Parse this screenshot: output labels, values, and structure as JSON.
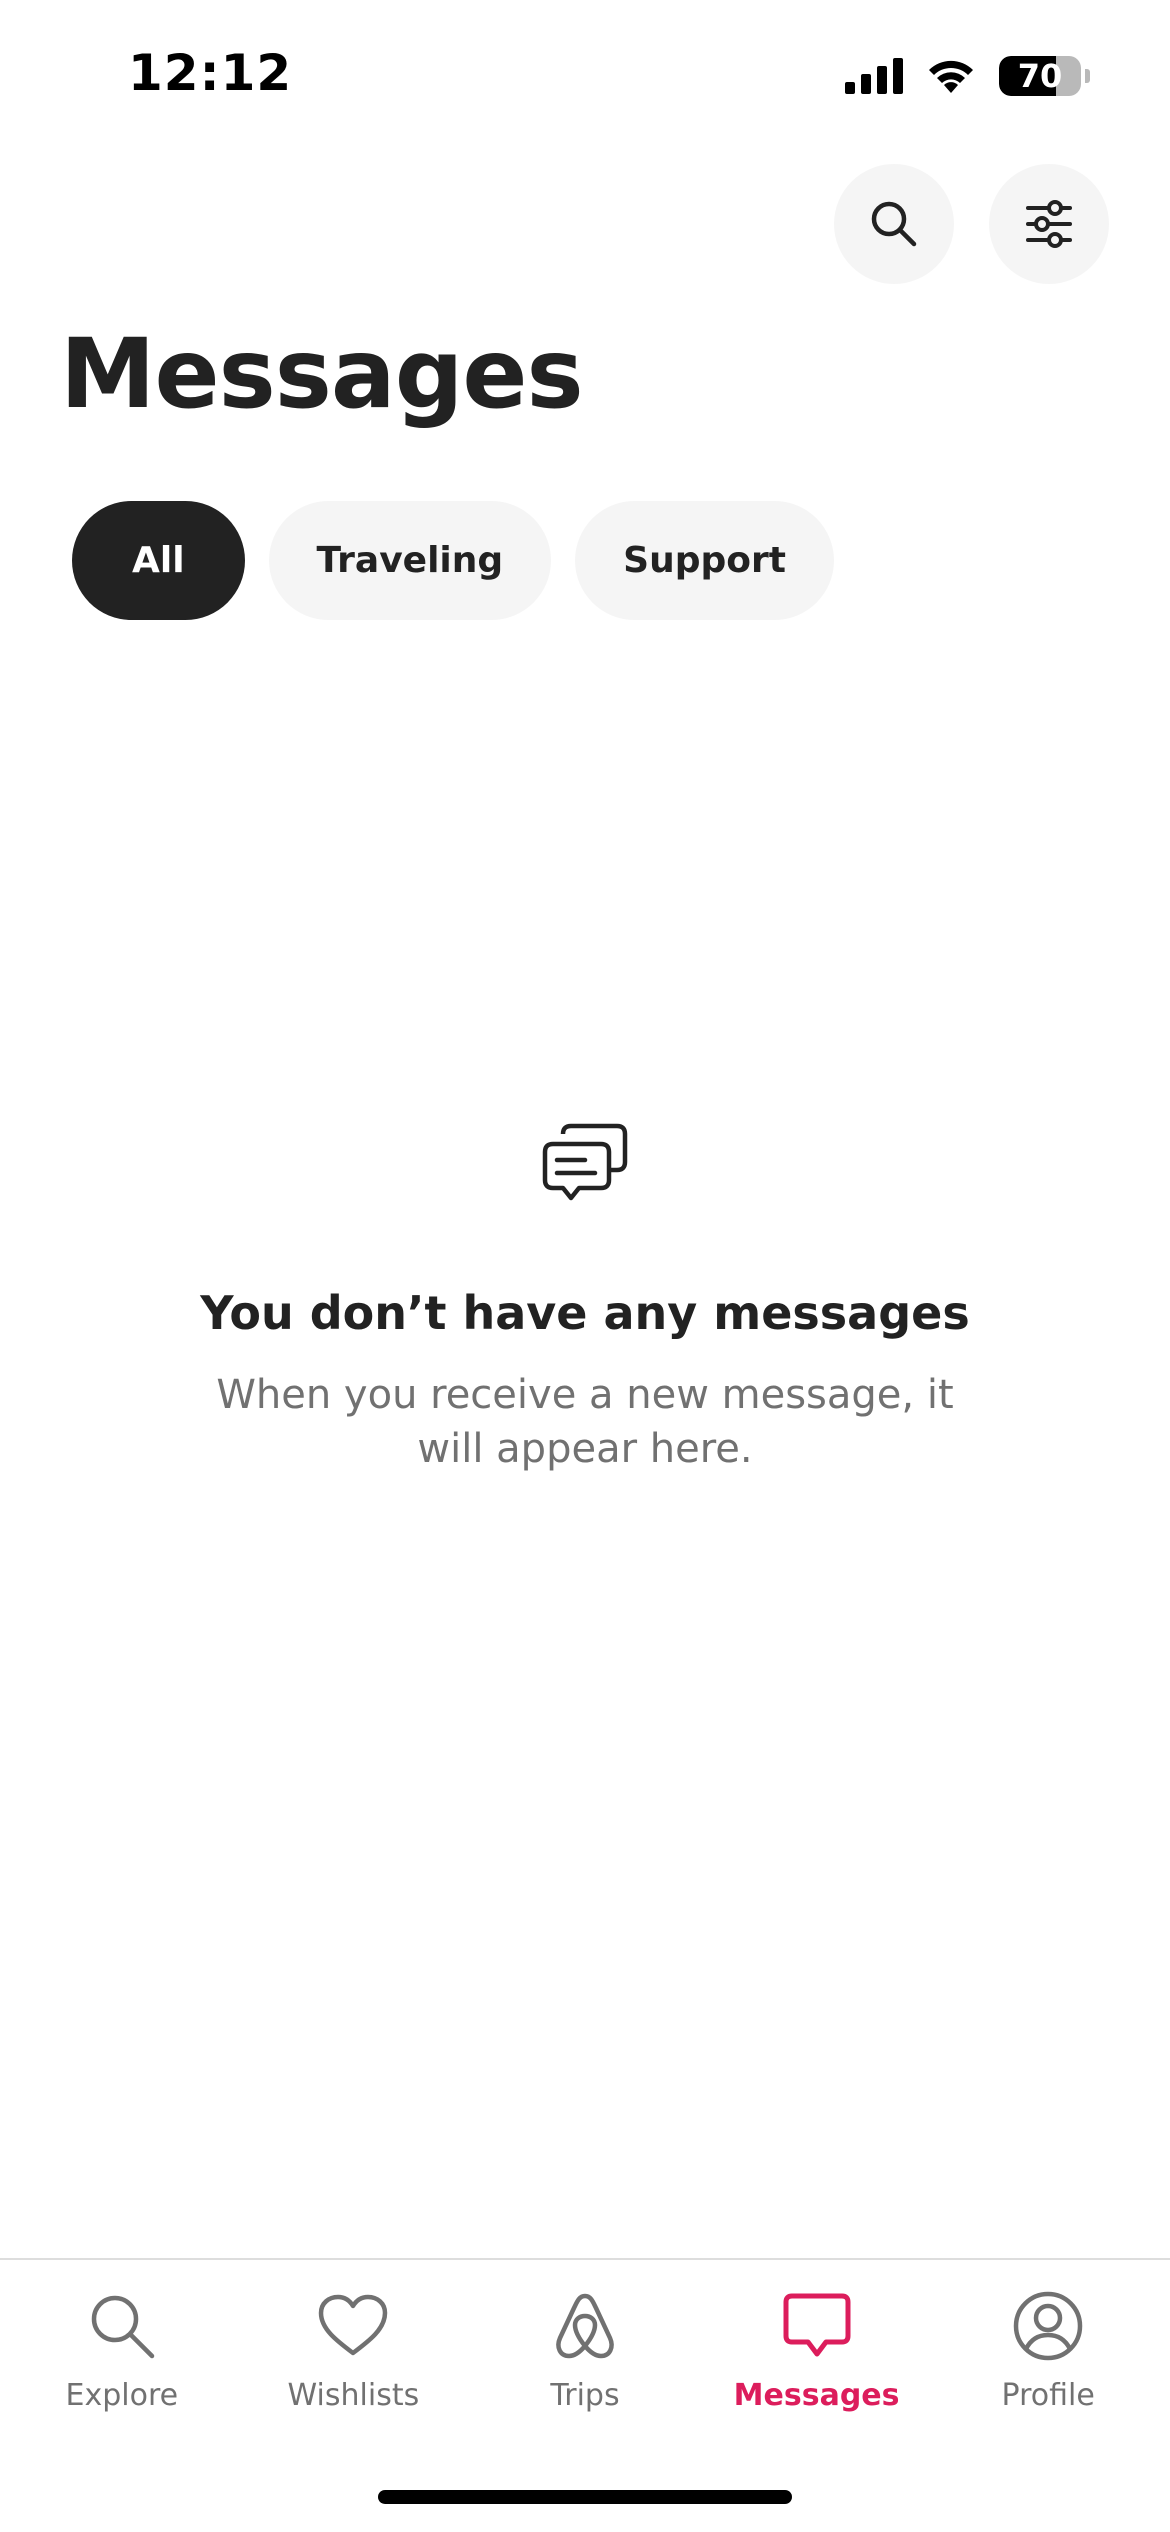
{
  "status_bar": {
    "time": "12:12",
    "battery_level": 70,
    "battery_text": "70"
  },
  "header": {
    "title": "Messages",
    "search_icon": "search-icon",
    "filter_icon": "sliders-icon"
  },
  "filters": [
    {
      "label": "All",
      "active": true
    },
    {
      "label": "Traveling",
      "active": false
    },
    {
      "label": "Support",
      "active": false
    }
  ],
  "empty_state": {
    "icon": "chat-bubbles-icon",
    "title": "You don’t have any messages",
    "subtitle": "When you receive a new message, it will appear here."
  },
  "nav": {
    "items": [
      {
        "label": "Explore",
        "icon": "search-icon",
        "active": false
      },
      {
        "label": "Wishlists",
        "icon": "heart-icon",
        "active": false
      },
      {
        "label": "Trips",
        "icon": "airbnb-logo-icon",
        "active": false
      },
      {
        "label": "Messages",
        "icon": "message-icon",
        "active": true
      },
      {
        "label": "Profile",
        "icon": "profile-icon",
        "active": false
      }
    ]
  },
  "colors": {
    "accent": "#dc1d5c",
    "text_primary": "#222222",
    "text_secondary": "#717171",
    "chip_bg": "#f5f5f5"
  }
}
